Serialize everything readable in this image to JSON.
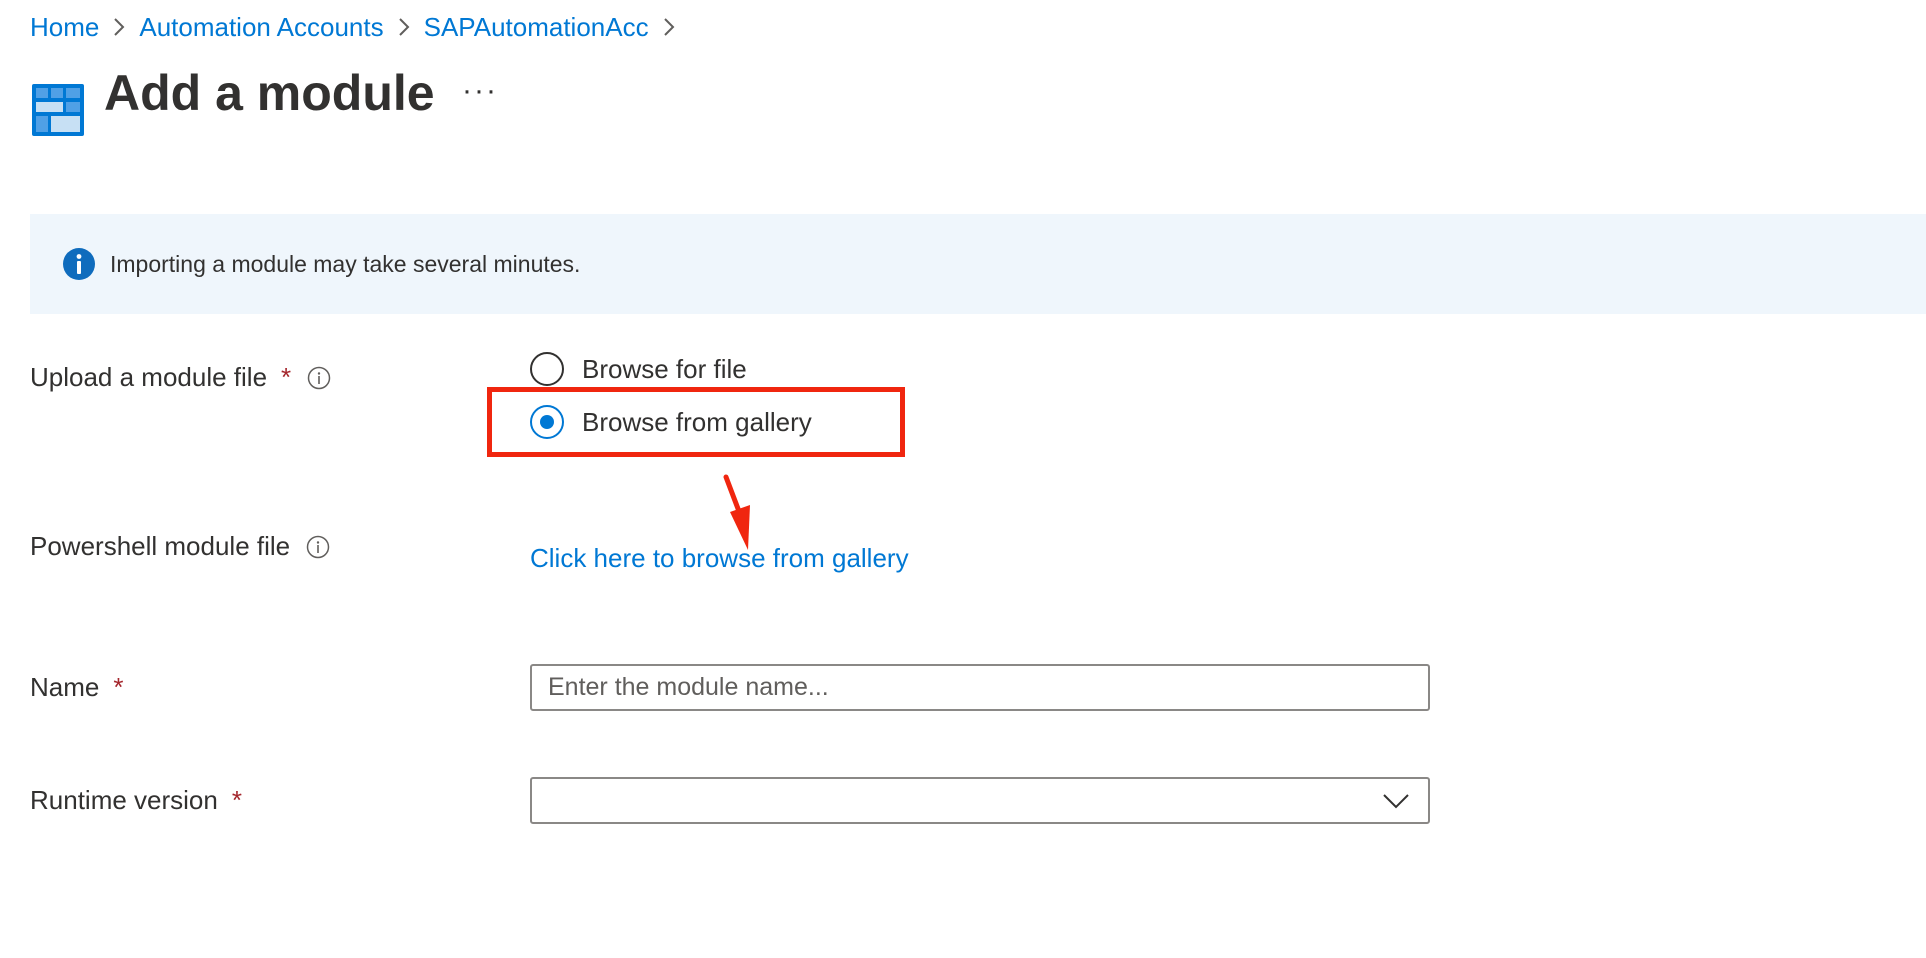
{
  "breadcrumb": [
    {
      "label": "Home"
    },
    {
      "label": "Automation Accounts"
    },
    {
      "label": "SAPAutomationAcc"
    }
  ],
  "page": {
    "title": "Add a module",
    "more_label": "···",
    "icon": "module-grid-icon"
  },
  "banner": {
    "icon": "info-filled-icon",
    "text": "Importing a module may take several minutes."
  },
  "form": {
    "upload": {
      "label": "Upload a module file",
      "required": "*",
      "options": [
        {
          "label": "Browse for file",
          "selected": false
        },
        {
          "label": "Browse from gallery",
          "selected": true
        }
      ]
    },
    "powershell": {
      "label": "Powershell module file",
      "link": "Click here to browse from gallery"
    },
    "name": {
      "label": "Name",
      "required": "*",
      "value": "",
      "placeholder": "Enter the module name..."
    },
    "runtime": {
      "label": "Runtime version",
      "required": "*",
      "value": ""
    }
  },
  "colors": {
    "link": "#0078d4",
    "annotation": "#f0260f",
    "required": "#a4262c",
    "banner_bg": "#eff6fc"
  }
}
